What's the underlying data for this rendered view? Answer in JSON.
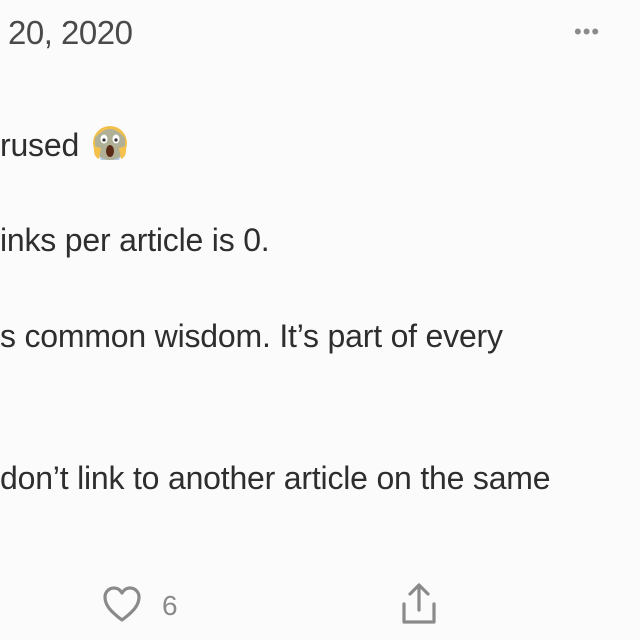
{
  "post": {
    "date": "20, 2020",
    "more_glyph": "•••",
    "lines": [
      "rused",
      "inks per article is 0.",
      "s common wisdom. It’s part of every",
      "don’t link to another article on the same"
    ],
    "emoji": "scream-face-emoji"
  },
  "actions": {
    "like_icon": "heart-icon",
    "like_count": "6",
    "share_icon": "share-icon"
  },
  "colors": {
    "background": "#fbfbfb",
    "text": "#2e2e2e",
    "muted": "#8a8a8a"
  }
}
